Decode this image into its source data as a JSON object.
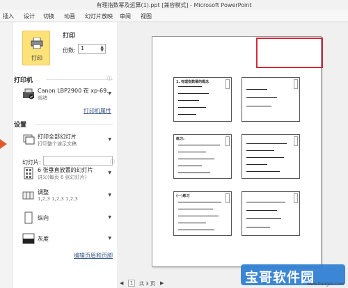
{
  "window": {
    "title": "有理指数幂及运算(1).ppt [兼容模式] - Microsoft PowerPoint"
  },
  "ribbon": {
    "tabs": [
      "插入",
      "设计",
      "切换",
      "动画",
      "幻灯片放映",
      "审阅",
      "视图"
    ]
  },
  "print": {
    "button_label": "打印",
    "title": "打印",
    "copies_label": "份数:",
    "copies_value": "1"
  },
  "printer": {
    "section_title": "打印机",
    "name": "Canon LBP2900 在 xp-69...",
    "status": "就绪",
    "properties_link": "打印机属性"
  },
  "settings": {
    "section_title": "设置",
    "print_range": {
      "main": "打印全部幻灯片",
      "sub": "打印整个演示文稿"
    },
    "slides_label": "幻灯片:",
    "layout": {
      "main": "6 张垂直放置的幻灯片",
      "sub": "讲义(每页 6 张幻灯片)"
    },
    "collate": {
      "main": "调整",
      "sub": "1,2,3   1,2,3   1,2,3"
    },
    "orientation": {
      "main": "纵向"
    },
    "color": {
      "main": "灰度"
    },
    "header_footer_link": "编辑页眉和页脚"
  },
  "preview": {
    "current_page": "1",
    "total_pages": "共 3 页",
    "slides_titles": [
      "1. 有理指数幂的概念",
      "",
      "练习:",
      "",
      "(一)练习",
      ""
    ]
  },
  "watermark": {
    "text": "宝哥软件园",
    "url": "www.baogeo.com"
  },
  "colors": {
    "accent": "#fde27a",
    "highlight": "#d12a3a",
    "arrow": "#e35a2a"
  }
}
